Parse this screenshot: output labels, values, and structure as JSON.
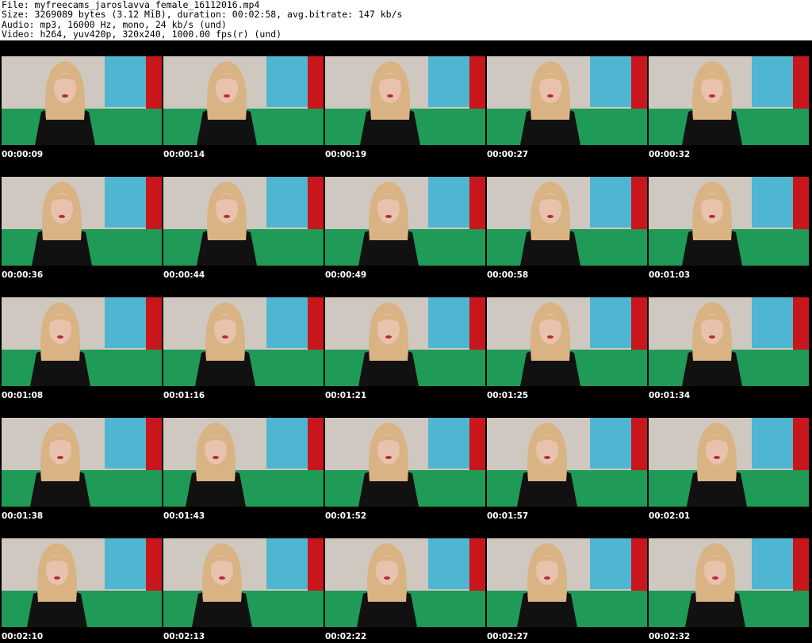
{
  "header": {
    "line1": "File: myfreecams_jaroslavva_female_16112016.mp4",
    "line2": "Size: 3269089 bytes (3.12 MiB), duration: 00:02:58, avg.bitrate: 147 kb/s",
    "line3": "Audio: mp3, 16000 Hz, mono, 24 kb/s (und)",
    "line4": "Video: h264, yuv420p, 320x240, 1000.00 fps(r) (und)"
  },
  "thumbnails": [
    {
      "timestamp": "00:00:09"
    },
    {
      "timestamp": "00:00:14"
    },
    {
      "timestamp": "00:00:19"
    },
    {
      "timestamp": "00:00:27"
    },
    {
      "timestamp": "00:00:32"
    },
    {
      "timestamp": "00:00:36"
    },
    {
      "timestamp": "00:00:44"
    },
    {
      "timestamp": "00:00:49"
    },
    {
      "timestamp": "00:00:58"
    },
    {
      "timestamp": "00:01:03"
    },
    {
      "timestamp": "00:01:08"
    },
    {
      "timestamp": "00:01:16"
    },
    {
      "timestamp": "00:01:21"
    },
    {
      "timestamp": "00:01:25"
    },
    {
      "timestamp": "00:01:34"
    },
    {
      "timestamp": "00:01:38"
    },
    {
      "timestamp": "00:01:43"
    },
    {
      "timestamp": "00:01:52"
    },
    {
      "timestamp": "00:01:57"
    },
    {
      "timestamp": "00:02:01"
    },
    {
      "timestamp": "00:02:10"
    },
    {
      "timestamp": "00:02:13"
    },
    {
      "timestamp": "00:02:22"
    },
    {
      "timestamp": "00:02:27"
    },
    {
      "timestamp": "00:02:32"
    }
  ],
  "colors": {
    "wall": "#cfc8c0",
    "sofa": "#1f9a57",
    "curtain_red": "#c8161c",
    "poster_blue": "#4fb6d2",
    "hair": "#d9b383",
    "shirt": "#111111",
    "skin": "#e9c2ad"
  }
}
